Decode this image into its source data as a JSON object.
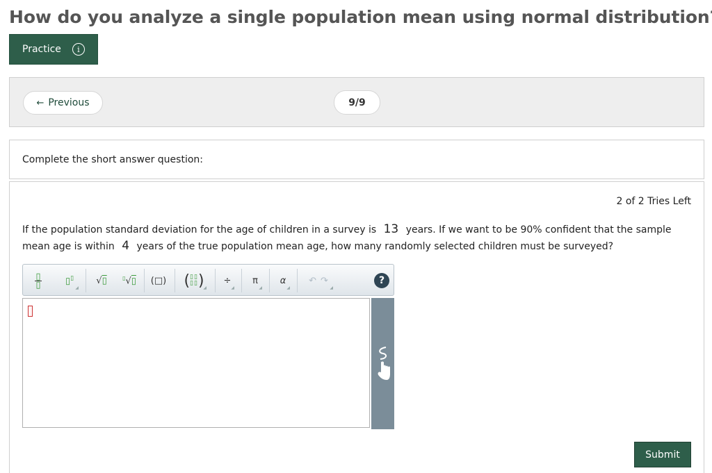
{
  "page": {
    "title": "How do you analyze a single population mean using normal distribution?"
  },
  "practice": {
    "label": "Practice",
    "info_icon": "i"
  },
  "nav": {
    "previous_label": "Previous",
    "previous_icon": "←",
    "counter": "9/9"
  },
  "instructions": {
    "text": "Complete the short answer question:"
  },
  "question": {
    "tries": "2 of 2 Tries Left",
    "part1": "If the population standard deviation for the age of children in a survey is",
    "value1": "13",
    "part2": "years.  If we want to be 90% confident that the sample mean age is within",
    "value2": "4",
    "part3": "years of the true population mean age, how many randomly selected children must be surveyed?"
  },
  "toolbar": {
    "sqrt": "√",
    "paren": "(□)",
    "divide": "÷",
    "pi": "π",
    "alpha": "α",
    "undo": "↶",
    "redo": "↷",
    "help": "?"
  },
  "submit": {
    "label": "Submit"
  },
  "colors": {
    "brand_green": "#2e5e4a",
    "panel_gray": "#eeeeee",
    "side_panel": "#7b8d99"
  }
}
